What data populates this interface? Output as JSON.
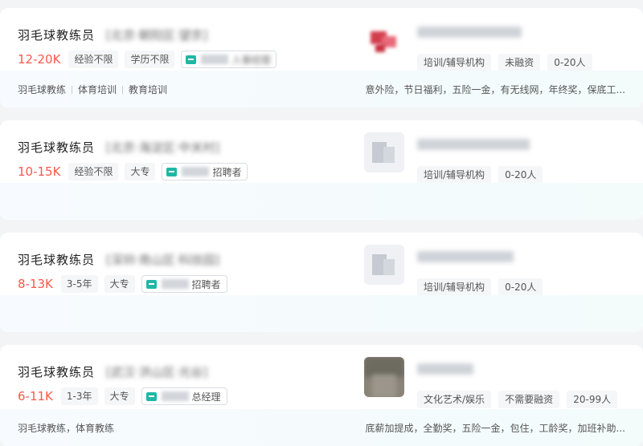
{
  "jobs": [
    {
      "title": "羽毛球教练员",
      "location": "[北京·朝阳区·望京]",
      "salary": "12-20K",
      "tags": [
        "经验不限",
        "学历不限"
      ],
      "recruiter": "人事经理",
      "company_tags": [
        "培训/辅导机构",
        "未融资",
        "0-20人"
      ],
      "footer_left": [
        "羽毛球教练",
        "体育培训",
        "教育培训"
      ],
      "footer_right": "意外险，节日福利，五险一金，有无线网，年终奖，保底工..."
    },
    {
      "title": "羽毛球教练员",
      "location": "[北京·海淀区·中关村]",
      "salary": "10-15K",
      "tags": [
        "经验不限",
        "大专"
      ],
      "recruiter": "招聘者",
      "company_tags": [
        "培训/辅导机构",
        "0-20人"
      ],
      "footer_left": [],
      "footer_right": ""
    },
    {
      "title": "羽毛球教练员",
      "location": "[深圳·南山区·科技园]",
      "salary": "8-13K",
      "tags": [
        "3-5年",
        "大专"
      ],
      "recruiter": "招聘者",
      "company_tags": [
        "培训/辅导机构",
        "0-20人"
      ],
      "footer_left": [],
      "footer_right": ""
    },
    {
      "title": "羽毛球教练员",
      "location": "[武汉·洪山区·光谷]",
      "salary": "6-11K",
      "tags": [
        "1-3年",
        "大专"
      ],
      "recruiter": "总经理",
      "company_tags": [
        "文化艺术/娱乐",
        "不需要融资",
        "20-99人"
      ],
      "footer_left_text": "羽毛球教练，体育教练",
      "footer_right": "底薪加提成，全勤奖，五险一金，包住，工龄奖，加班补助..."
    }
  ]
}
